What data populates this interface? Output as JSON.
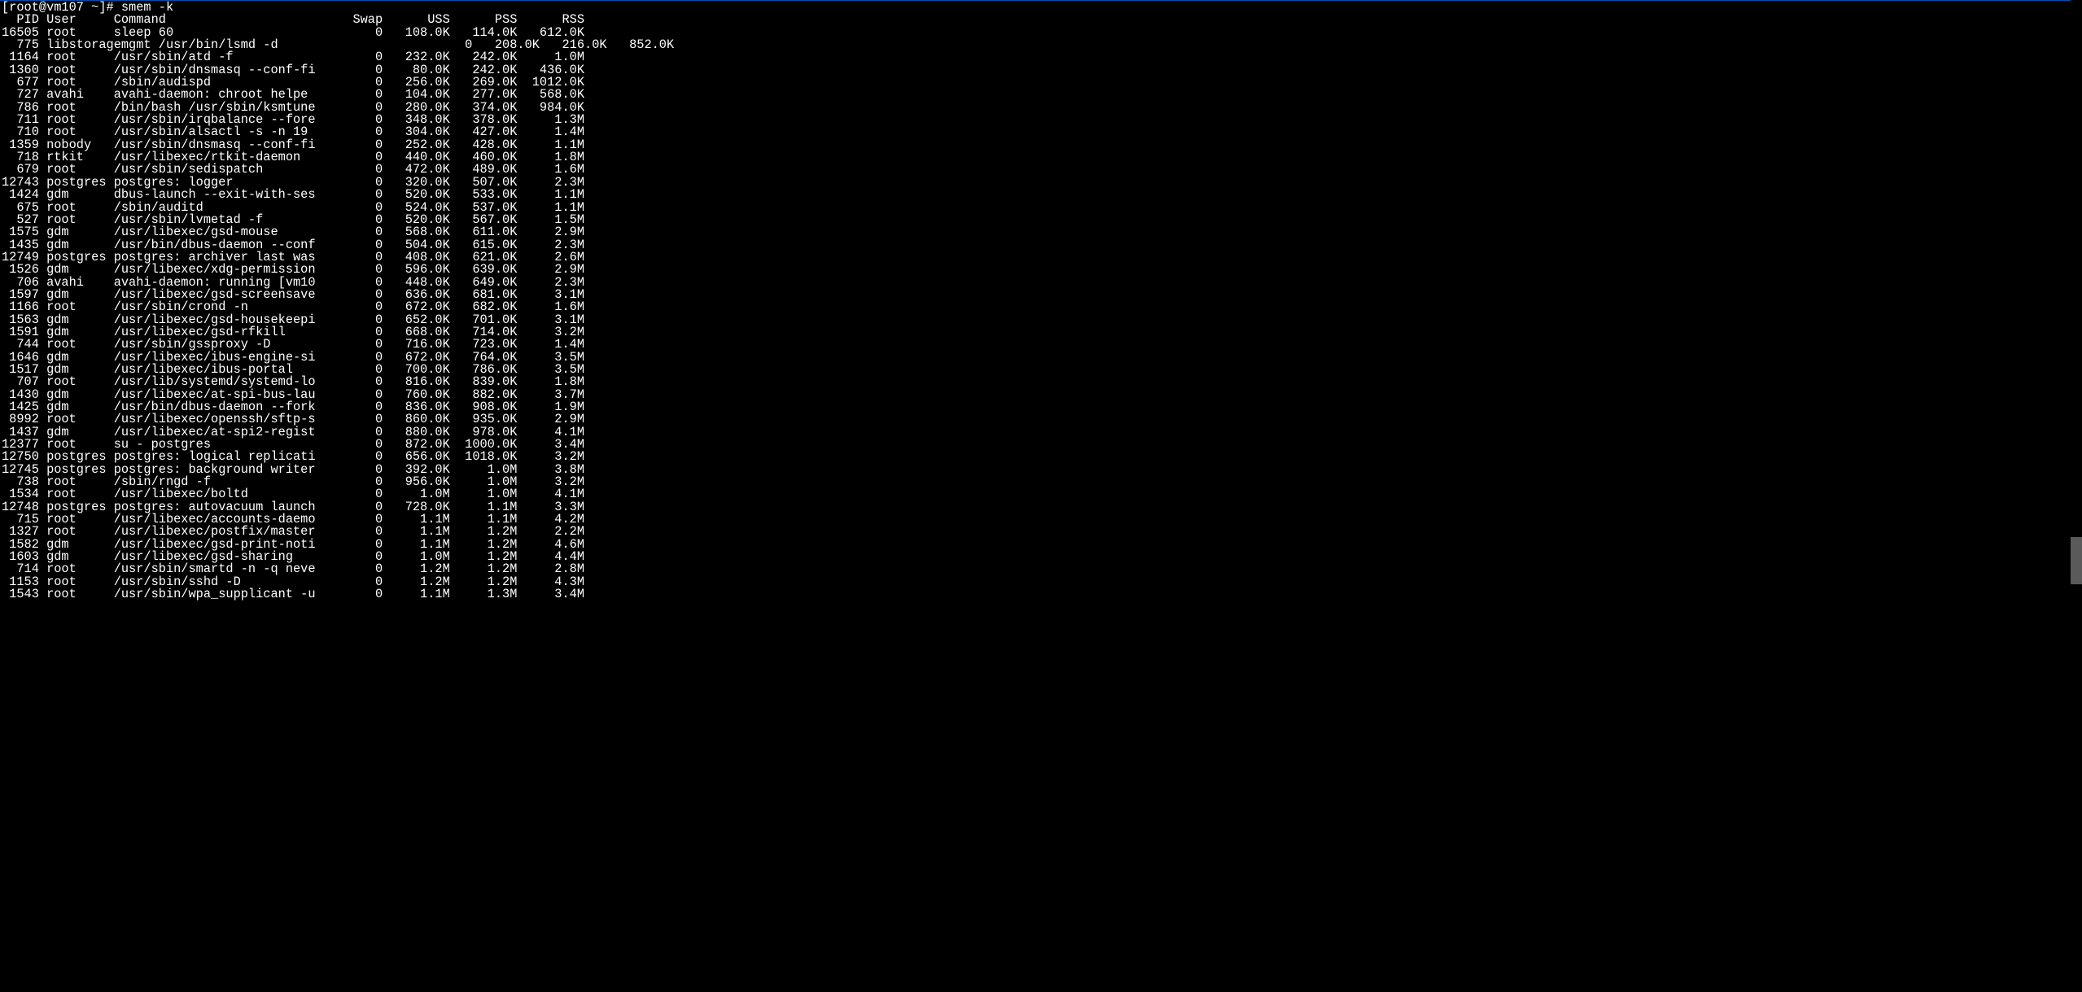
{
  "prompt": "[root@vm107 ~]# smem -k",
  "headers": {
    "pid": "PID",
    "user": "User",
    "command": "Command",
    "swap": "Swap",
    "uss": "USS",
    "pss": "PSS",
    "rss": "RSS"
  },
  "cols": {
    "pid_w": 5,
    "user_w": 8,
    "cmd_w": 27,
    "num_w": 9
  },
  "rows": [
    {
      "pid": "16505",
      "user": "root",
      "cmd": "sleep 60",
      "swap": "0",
      "uss": "108.0K",
      "pss": "114.0K",
      "rss": "612.0K",
      "shift": 0
    },
    {
      "pid": "775",
      "user": "libstoragemgmt",
      "cmd": "/usr/bin/lsmd -d",
      "swap": "0",
      "uss": "208.0K",
      "pss": "216.0K",
      "rss": "852.0K",
      "shift": 6
    },
    {
      "pid": "1164",
      "user": "root",
      "cmd": "/usr/sbin/atd -f",
      "swap": "0",
      "uss": "232.0K",
      "pss": "242.0K",
      "rss": "1.0M",
      "shift": 0
    },
    {
      "pid": "1360",
      "user": "root",
      "cmd": "/usr/sbin/dnsmasq --conf-fi",
      "swap": "0",
      "uss": "80.0K",
      "pss": "242.0K",
      "rss": "436.0K",
      "shift": 0
    },
    {
      "pid": "677",
      "user": "root",
      "cmd": "/sbin/audispd",
      "swap": "0",
      "uss": "256.0K",
      "pss": "269.0K",
      "rss": "1012.0K",
      "shift": 0
    },
    {
      "pid": "727",
      "user": "avahi",
      "cmd": "avahi-daemon: chroot helpe",
      "swap": "0",
      "uss": "104.0K",
      "pss": "277.0K",
      "rss": "568.0K",
      "shift": 0
    },
    {
      "pid": "786",
      "user": "root",
      "cmd": "/bin/bash /usr/sbin/ksmtune",
      "swap": "0",
      "uss": "280.0K",
      "pss": "374.0K",
      "rss": "984.0K",
      "shift": 0
    },
    {
      "pid": "711",
      "user": "root",
      "cmd": "/usr/sbin/irqbalance --fore",
      "swap": "0",
      "uss": "348.0K",
      "pss": "378.0K",
      "rss": "1.3M",
      "shift": 0
    },
    {
      "pid": "710",
      "user": "root",
      "cmd": "/usr/sbin/alsactl -s -n 19 ",
      "swap": "0",
      "uss": "304.0K",
      "pss": "427.0K",
      "rss": "1.4M",
      "shift": 0
    },
    {
      "pid": "1359",
      "user": "nobody",
      "cmd": "/usr/sbin/dnsmasq --conf-fi",
      "swap": "0",
      "uss": "252.0K",
      "pss": "428.0K",
      "rss": "1.1M",
      "shift": 0
    },
    {
      "pid": "718",
      "user": "rtkit",
      "cmd": "/usr/libexec/rtkit-daemon",
      "swap": "0",
      "uss": "440.0K",
      "pss": "460.0K",
      "rss": "1.8M",
      "shift": 0
    },
    {
      "pid": "679",
      "user": "root",
      "cmd": "/usr/sbin/sedispatch",
      "swap": "0",
      "uss": "472.0K",
      "pss": "489.0K",
      "rss": "1.6M",
      "shift": 0
    },
    {
      "pid": "12743",
      "user": "postgres",
      "cmd": "postgres: logger",
      "swap": "0",
      "uss": "320.0K",
      "pss": "507.0K",
      "rss": "2.3M",
      "shift": 0
    },
    {
      "pid": "1424",
      "user": "gdm",
      "cmd": "dbus-launch --exit-with-ses",
      "swap": "0",
      "uss": "520.0K",
      "pss": "533.0K",
      "rss": "1.1M",
      "shift": 0
    },
    {
      "pid": "675",
      "user": "root",
      "cmd": "/sbin/auditd",
      "swap": "0",
      "uss": "524.0K",
      "pss": "537.0K",
      "rss": "1.1M",
      "shift": 0
    },
    {
      "pid": "527",
      "user": "root",
      "cmd": "/usr/sbin/lvmetad -f",
      "swap": "0",
      "uss": "520.0K",
      "pss": "567.0K",
      "rss": "1.5M",
      "shift": 0
    },
    {
      "pid": "1575",
      "user": "gdm",
      "cmd": "/usr/libexec/gsd-mouse",
      "swap": "0",
      "uss": "568.0K",
      "pss": "611.0K",
      "rss": "2.9M",
      "shift": 0
    },
    {
      "pid": "1435",
      "user": "gdm",
      "cmd": "/usr/bin/dbus-daemon --conf",
      "swap": "0",
      "uss": "504.0K",
      "pss": "615.0K",
      "rss": "2.3M",
      "shift": 0
    },
    {
      "pid": "12749",
      "user": "postgres",
      "cmd": "postgres: archiver last was",
      "swap": "0",
      "uss": "408.0K",
      "pss": "621.0K",
      "rss": "2.6M",
      "shift": 0
    },
    {
      "pid": "1526",
      "user": "gdm",
      "cmd": "/usr/libexec/xdg-permission",
      "swap": "0",
      "uss": "596.0K",
      "pss": "639.0K",
      "rss": "2.9M",
      "shift": 0
    },
    {
      "pid": "706",
      "user": "avahi",
      "cmd": "avahi-daemon: running [vm10",
      "swap": "0",
      "uss": "448.0K",
      "pss": "649.0K",
      "rss": "2.3M",
      "shift": 0
    },
    {
      "pid": "1597",
      "user": "gdm",
      "cmd": "/usr/libexec/gsd-screensave",
      "swap": "0",
      "uss": "636.0K",
      "pss": "681.0K",
      "rss": "3.1M",
      "shift": 0
    },
    {
      "pid": "1166",
      "user": "root",
      "cmd": "/usr/sbin/crond -n",
      "swap": "0",
      "uss": "672.0K",
      "pss": "682.0K",
      "rss": "1.6M",
      "shift": 0
    },
    {
      "pid": "1563",
      "user": "gdm",
      "cmd": "/usr/libexec/gsd-housekeepi",
      "swap": "0",
      "uss": "652.0K",
      "pss": "701.0K",
      "rss": "3.1M",
      "shift": 0
    },
    {
      "pid": "1591",
      "user": "gdm",
      "cmd": "/usr/libexec/gsd-rfkill",
      "swap": "0",
      "uss": "668.0K",
      "pss": "714.0K",
      "rss": "3.2M",
      "shift": 0
    },
    {
      "pid": "744",
      "user": "root",
      "cmd": "/usr/sbin/gssproxy -D",
      "swap": "0",
      "uss": "716.0K",
      "pss": "723.0K",
      "rss": "1.4M",
      "shift": 0
    },
    {
      "pid": "1646",
      "user": "gdm",
      "cmd": "/usr/libexec/ibus-engine-si",
      "swap": "0",
      "uss": "672.0K",
      "pss": "764.0K",
      "rss": "3.5M",
      "shift": 0
    },
    {
      "pid": "1517",
      "user": "gdm",
      "cmd": "/usr/libexec/ibus-portal",
      "swap": "0",
      "uss": "700.0K",
      "pss": "786.0K",
      "rss": "3.5M",
      "shift": 0
    },
    {
      "pid": "707",
      "user": "root",
      "cmd": "/usr/lib/systemd/systemd-lo",
      "swap": "0",
      "uss": "816.0K",
      "pss": "839.0K",
      "rss": "1.8M",
      "shift": 0
    },
    {
      "pid": "1430",
      "user": "gdm",
      "cmd": "/usr/libexec/at-spi-bus-lau",
      "swap": "0",
      "uss": "760.0K",
      "pss": "882.0K",
      "rss": "3.7M",
      "shift": 0
    },
    {
      "pid": "1425",
      "user": "gdm",
      "cmd": "/usr/bin/dbus-daemon --fork",
      "swap": "0",
      "uss": "836.0K",
      "pss": "908.0K",
      "rss": "1.9M",
      "shift": 0
    },
    {
      "pid": "8992",
      "user": "root",
      "cmd": "/usr/libexec/openssh/sftp-s",
      "swap": "0",
      "uss": "860.0K",
      "pss": "935.0K",
      "rss": "2.9M",
      "shift": 0
    },
    {
      "pid": "1437",
      "user": "gdm",
      "cmd": "/usr/libexec/at-spi2-regist",
      "swap": "0",
      "uss": "880.0K",
      "pss": "978.0K",
      "rss": "4.1M",
      "shift": 0
    },
    {
      "pid": "12377",
      "user": "root",
      "cmd": "su - postgres",
      "swap": "0",
      "uss": "872.0K",
      "pss": "1000.0K",
      "rss": "3.4M",
      "shift": 0
    },
    {
      "pid": "12750",
      "user": "postgres",
      "cmd": "postgres: logical replicati",
      "swap": "0",
      "uss": "656.0K",
      "pss": "1018.0K",
      "rss": "3.2M",
      "shift": 0
    },
    {
      "pid": "12745",
      "user": "postgres",
      "cmd": "postgres: background writer",
      "swap": "0",
      "uss": "392.0K",
      "pss": "1.0M",
      "rss": "3.8M",
      "shift": 0
    },
    {
      "pid": "738",
      "user": "root",
      "cmd": "/sbin/rngd -f",
      "swap": "0",
      "uss": "956.0K",
      "pss": "1.0M",
      "rss": "3.2M",
      "shift": 0
    },
    {
      "pid": "1534",
      "user": "root",
      "cmd": "/usr/libexec/boltd",
      "swap": "0",
      "uss": "1.0M",
      "pss": "1.0M",
      "rss": "4.1M",
      "shift": 0
    },
    {
      "pid": "12748",
      "user": "postgres",
      "cmd": "postgres: autovacuum launch",
      "swap": "0",
      "uss": "728.0K",
      "pss": "1.1M",
      "rss": "3.3M",
      "shift": 0
    },
    {
      "pid": "715",
      "user": "root",
      "cmd": "/usr/libexec/accounts-daemo",
      "swap": "0",
      "uss": "1.1M",
      "pss": "1.1M",
      "rss": "4.2M",
      "shift": 0
    },
    {
      "pid": "1327",
      "user": "root",
      "cmd": "/usr/libexec/postfix/master",
      "swap": "0",
      "uss": "1.1M",
      "pss": "1.2M",
      "rss": "2.2M",
      "shift": 0
    },
    {
      "pid": "1582",
      "user": "gdm",
      "cmd": "/usr/libexec/gsd-print-noti",
      "swap": "0",
      "uss": "1.1M",
      "pss": "1.2M",
      "rss": "4.6M",
      "shift": 0
    },
    {
      "pid": "1603",
      "user": "gdm",
      "cmd": "/usr/libexec/gsd-sharing",
      "swap": "0",
      "uss": "1.0M",
      "pss": "1.2M",
      "rss": "4.4M",
      "shift": 0
    },
    {
      "pid": "714",
      "user": "root",
      "cmd": "/usr/sbin/smartd -n -q neve",
      "swap": "0",
      "uss": "1.2M",
      "pss": "1.2M",
      "rss": "2.8M",
      "shift": 0
    },
    {
      "pid": "1153",
      "user": "root",
      "cmd": "/usr/sbin/sshd -D",
      "swap": "0",
      "uss": "1.2M",
      "pss": "1.2M",
      "rss": "4.3M",
      "shift": 0
    },
    {
      "pid": "1543",
      "user": "root",
      "cmd": "/usr/sbin/wpa_supplicant -u",
      "swap": "0",
      "uss": "1.1M",
      "pss": "1.3M",
      "rss": "3.4M",
      "shift": 0
    }
  ]
}
